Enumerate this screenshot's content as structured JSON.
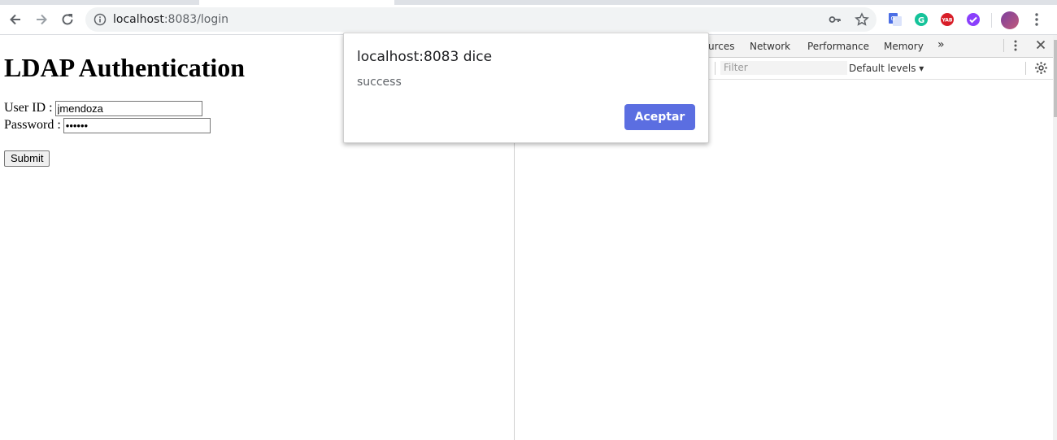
{
  "browser": {
    "url_host": "localhost",
    "url_rest": ":8083/login"
  },
  "page": {
    "heading": "LDAP Authentication",
    "user_label": "User ID :",
    "user_value": "jmendoza",
    "password_label": "Password :",
    "password_value": "••••••",
    "submit_label": "Submit"
  },
  "devtools": {
    "tabs": [
      "urces",
      "Network",
      "Performance",
      "Memory",
      "»"
    ],
    "filter_placeholder": "Filter",
    "levels_label": "Default levels ▾"
  },
  "alert": {
    "title": "localhost:8083 dice",
    "message": "success",
    "button_label": "Aceptar"
  },
  "colors": {
    "accent_button": "#5b6ee1",
    "extensions": [
      "#4b6ee5",
      "#15c39a",
      "#d81e28",
      "#8a3ffc"
    ]
  }
}
